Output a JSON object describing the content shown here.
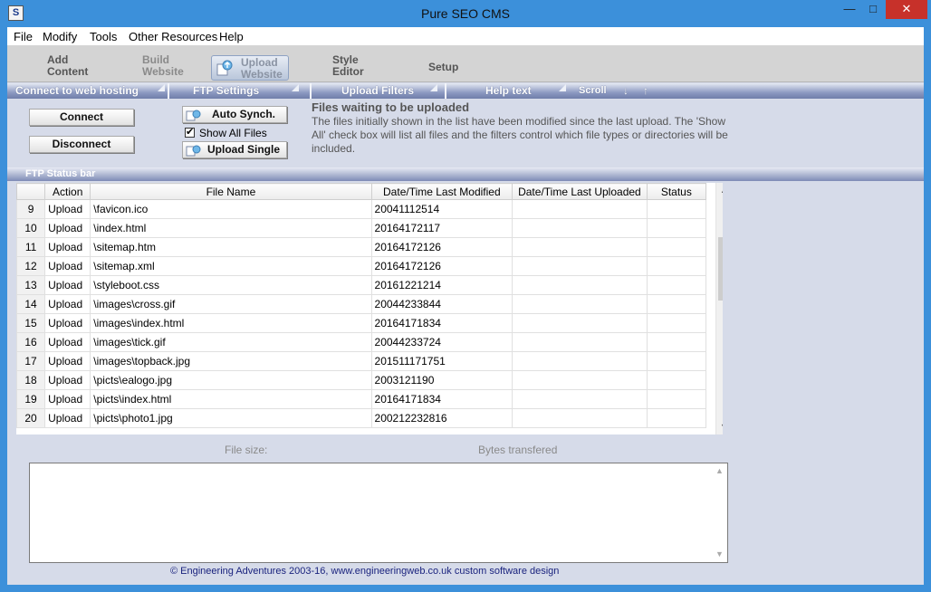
{
  "window": {
    "title": "Pure SEO CMS",
    "icon": "app-icon"
  },
  "menu": [
    "File",
    "Modify",
    "Tools",
    "Other Resources",
    "Help"
  ],
  "toolbar": {
    "add": [
      "Add",
      "Content"
    ],
    "build": [
      "Build",
      "Website"
    ],
    "upload": [
      "Upload",
      "Website"
    ],
    "style": [
      "Style",
      "Editor"
    ],
    "setup": "Setup"
  },
  "tabs": {
    "connect": "Connect to web hosting",
    "ftp": "FTP Settings",
    "filters": "Upload Filters",
    "help": "Help text",
    "scroll": "Scroll",
    "down_arrow": "↓",
    "up_arrow": "↑"
  },
  "controls": {
    "connect": "Connect",
    "disconnect": "Disconnect",
    "auto_synch": "Auto Synch.",
    "show_all": "Show All Files",
    "show_all_checked": true,
    "upload_single": "Upload Single"
  },
  "help": {
    "title": "Files waiting to be uploaded",
    "body": "The files initially shown in the list have been modified since the last upload. The 'Show All' check box will list all files and the filters control which file types or directories will be included."
  },
  "status_bar": "FTP Status bar",
  "grid": {
    "columns": [
      "",
      "Action",
      "File Name",
      "Date/Time Last Modified",
      "Date/Time Last Uploaded",
      "Status"
    ],
    "rows": [
      [
        "9",
        "Upload",
        "\\favicon.ico",
        "20041112514",
        "",
        ""
      ],
      [
        "10",
        "Upload",
        "\\index.html",
        "20164172117",
        "",
        ""
      ],
      [
        "11",
        "Upload",
        "\\sitemap.htm",
        "20164172126",
        "",
        ""
      ],
      [
        "12",
        "Upload",
        "\\sitemap.xml",
        "20164172126",
        "",
        ""
      ],
      [
        "13",
        "Upload",
        "\\styleboot.css",
        "20161221214",
        "",
        ""
      ],
      [
        "14",
        "Upload",
        "\\images\\cross.gif",
        "20044233844",
        "",
        ""
      ],
      [
        "15",
        "Upload",
        "\\images\\index.html",
        "20164171834",
        "",
        ""
      ],
      [
        "16",
        "Upload",
        "\\images\\tick.gif",
        "20044233724",
        "",
        ""
      ],
      [
        "17",
        "Upload",
        "\\images\\topback.jpg",
        "201511171751",
        "",
        ""
      ],
      [
        "18",
        "Upload",
        "\\picts\\ealogo.jpg",
        "2003121190",
        "",
        ""
      ],
      [
        "19",
        "Upload",
        "\\picts\\index.html",
        "20164171834",
        "",
        ""
      ],
      [
        "20",
        "Upload",
        "\\picts\\photo1.jpg",
        "200212232816",
        "",
        ""
      ]
    ]
  },
  "info": {
    "file_size": "File size:",
    "bytes": "Bytes transfered"
  },
  "footer": "© Engineering Adventures 2003-16,  www.engineeringweb.co.uk custom software design"
}
